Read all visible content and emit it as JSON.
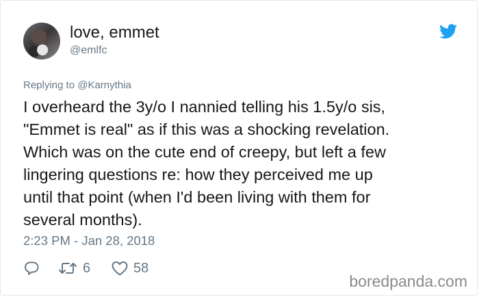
{
  "tweet": {
    "author_name": "love, emmet",
    "author_handle": "@emlfc",
    "replying_prefix": "Replying to ",
    "replying_to": "@Karnythia",
    "text": "I overheard the 3y/o I nannied telling his 1.5y/o sis,\n\"Emmet is real\" as if this was a shocking revelation.\nWhich was on the cute end of creepy, but left a few\nlingering questions re: how they perceived me up\nuntil that point (when I'd been living with them for\nseveral months).",
    "timestamp": "2:23 PM - Jan 28, 2018",
    "retweet_count": "6",
    "like_count": "58"
  },
  "icons": {
    "platform": "twitter-bird-icon",
    "reply": "reply-icon",
    "retweet": "retweet-icon",
    "like": "heart-icon"
  },
  "colors": {
    "twitter_blue": "#1da1f2",
    "secondary_text": "#657786",
    "primary_text": "#14171a"
  },
  "watermark": "boredpanda.com"
}
